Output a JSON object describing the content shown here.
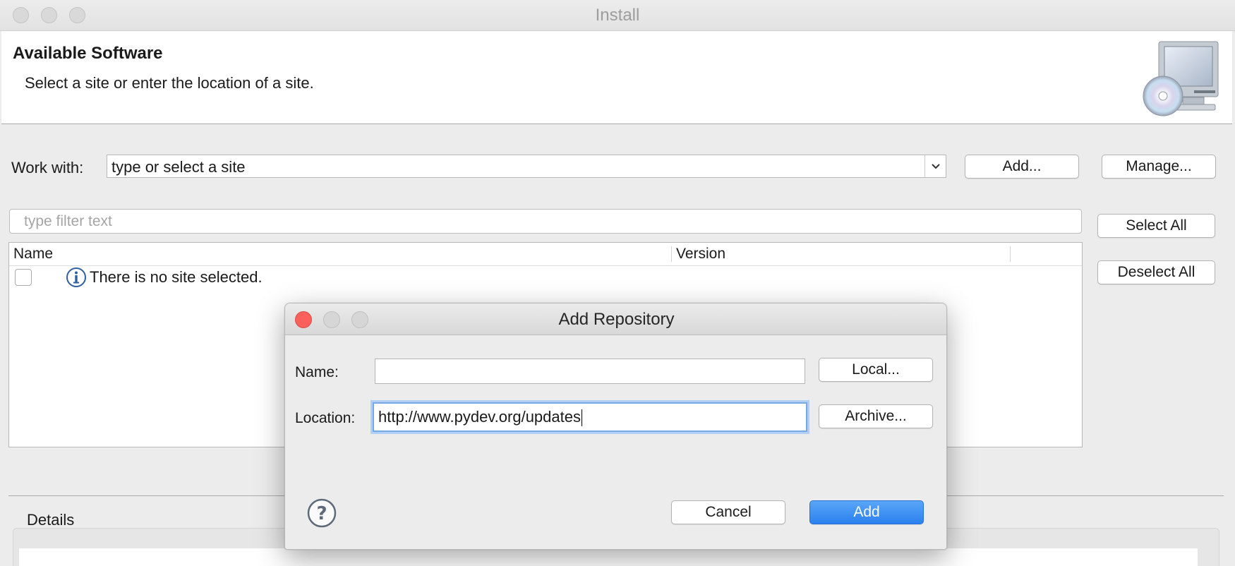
{
  "window": {
    "title": "Install"
  },
  "banner": {
    "title": "Available Software",
    "subtitle": "Select a site or enter the location of a site."
  },
  "work_with": {
    "label": "Work with:",
    "value": "type or select a site",
    "add_button": "Add...",
    "manage_button": "Manage..."
  },
  "filter": {
    "placeholder": "type filter text"
  },
  "side_buttons": {
    "select_all": "Select All",
    "deselect_all": "Deselect All"
  },
  "table": {
    "columns": [
      "Name",
      "Version"
    ],
    "message": "There is no site selected."
  },
  "details": {
    "label": "Details"
  },
  "dialog": {
    "title": "Add Repository",
    "name_label": "Name:",
    "name_value": "",
    "location_label": "Location:",
    "location_value": "http://www.pydev.org/updates",
    "local_button": "Local...",
    "archive_button": "Archive...",
    "cancel_button": "Cancel",
    "add_button": "Add"
  },
  "icons": {
    "monitor_cd": "monitor-cd-icon",
    "info": "info-icon",
    "help": "help-icon",
    "dropdown": "chevron-down-icon"
  },
  "colors": {
    "accent": "#2a80ee",
    "close_red": "#fc605c"
  }
}
